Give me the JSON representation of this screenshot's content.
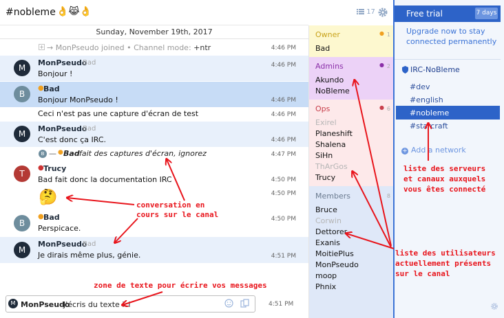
{
  "header": {
    "title": "#nobleme",
    "emoji": "👌😹👌",
    "user_count": "17"
  },
  "date_divider": "Sunday, November 19th, 2017",
  "messages": [
    {
      "type": "system",
      "text_pre": "→ MonPseudo",
      "text_join": "joined",
      "text_mode_label": "• Channel mode:",
      "text_mode": "+ntr",
      "time": "4:46 PM"
    },
    {
      "avatar": "M",
      "nick": "MonPseudo",
      "mode": "Bad",
      "text": "Bonjour !",
      "time": "4:46 PM"
    },
    {
      "avatar": "B",
      "nick": "Bad",
      "text": "Bonjour MonPseudo !",
      "time": "4:46 PM"
    },
    {
      "text": "Ceci n'est pas une capture d'écran de test",
      "time": "4:46 PM"
    },
    {
      "avatar": "M",
      "nick": "MonPseudo",
      "mode": "Bad",
      "text": "C'est donc ça IRC.",
      "time": "4:46 PM"
    },
    {
      "type": "action",
      "avatar": "B",
      "nick": "Bad",
      "text": "fait des captures d'écran, ignorez",
      "time": "4:47 PM"
    },
    {
      "avatar": "T",
      "nick": "Trucy",
      "text": "Bad fait donc la documentation IRC",
      "time": "4:50 PM"
    },
    {
      "emoji": "🤔",
      "time": "4:50 PM"
    },
    {
      "avatar": "B",
      "nick": "Bad",
      "text": "Perspicace.",
      "time": "4:50 PM"
    },
    {
      "avatar": "M",
      "nick": "MonPseudo",
      "mode": "Bad",
      "text": "Je dirais même plus, génie.",
      "time": "4:51 PM"
    }
  ],
  "members": {
    "owner": {
      "label": "Owner",
      "count": "1",
      "names": [
        "Bad"
      ]
    },
    "admins": {
      "label": "Admins",
      "count": "2",
      "names": [
        "Akundo",
        "NoBleme"
      ]
    },
    "ops": {
      "label": "Ops",
      "count": "6",
      "names": [
        "Exirel",
        "Planeshift",
        "Shalena",
        "SiHn",
        "ThArGos",
        "Trucy"
      ]
    },
    "members": {
      "label": "Members",
      "count": "8",
      "names": [
        "Bruce",
        "Corwin",
        "Dettorer",
        "Exanis",
        "MoitiePlus",
        "MonPseudo",
        "moop",
        "Phnix"
      ]
    }
  },
  "sidebar": {
    "trial_label": "Free trial",
    "trial_days": "7 days",
    "upgrade_text": "Upgrade now to stay connected permanently",
    "network": "IRC-NoBleme",
    "channels": [
      "#dev",
      "#english",
      "#nobleme",
      "#starcraft"
    ],
    "add_network": "Add a network"
  },
  "input": {
    "nick": "MonPseudo",
    "text": "J'écris du texte ici",
    "time": "4:51 PM"
  },
  "annotations": {
    "conversation": [
      "conversation en",
      "cours sur le canal"
    ],
    "servers": [
      "liste des serveurs",
      "et canaux auxquels",
      "vous êtes connecté"
    ],
    "users": [
      "liste des utilisateurs",
      "actuellement présents",
      "sur le canal"
    ],
    "textzone": "zone de texte pour écrire vos messages"
  },
  "colors": {
    "accent": "#2d63c8",
    "annotation": "#e8141b",
    "owner_bg": "#fdf8cf",
    "admins_bg": "#ecd2f7",
    "ops_bg": "#fde9ea",
    "members_bg": "#dfe8f8"
  }
}
